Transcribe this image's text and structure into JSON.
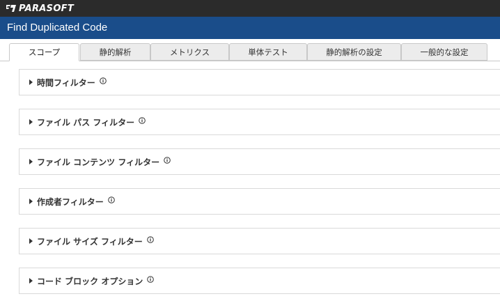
{
  "brand": {
    "name": "PARASOFT"
  },
  "window": {
    "title": "Find Duplicated Code"
  },
  "tabs": [
    {
      "label": "スコープ",
      "active": true
    },
    {
      "label": "静的解析",
      "active": false
    },
    {
      "label": "メトリクス",
      "active": false
    },
    {
      "label": "単体テスト",
      "active": false
    },
    {
      "label": "静的解析の設定",
      "active": false
    },
    {
      "label": "一般的な設定",
      "active": false
    }
  ],
  "sections": [
    {
      "label": "時間フィルター",
      "icon": "info-icon"
    },
    {
      "label": "ファイル パス フィルター",
      "icon": "info-icon"
    },
    {
      "label": "ファイル コンテンツ フィルター",
      "icon": "info-icon"
    },
    {
      "label": "作成者フィルター",
      "icon": "info-icon"
    },
    {
      "label": "ファイル サイズ フィルター",
      "icon": "info-icon"
    },
    {
      "label": "コード ブロック オプション",
      "icon": "info-icon"
    }
  ],
  "colors": {
    "brandbar": "#2b2b2b",
    "titlebar": "#1a4d8a",
    "tab_inactive": "#ececec"
  }
}
